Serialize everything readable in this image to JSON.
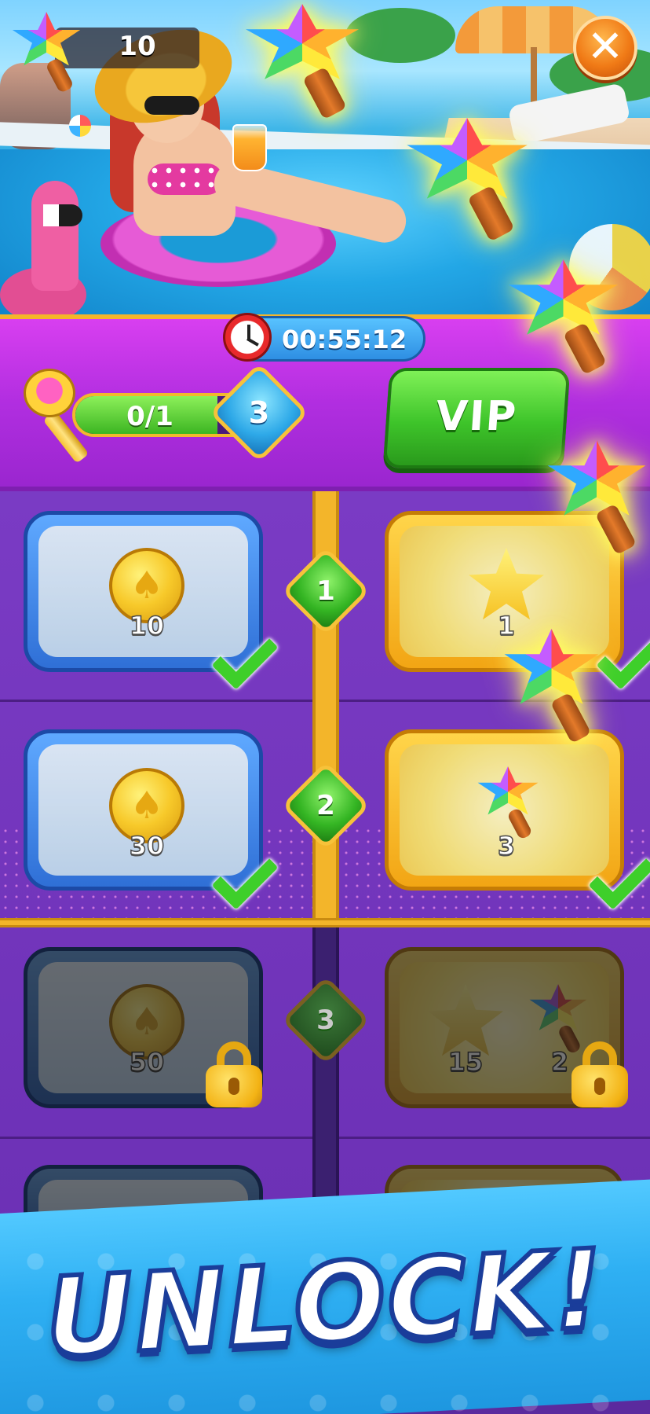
{
  "hud": {
    "wand_count": "10",
    "close_label": "✕"
  },
  "event": {
    "timer": "00:55:12",
    "key_progress": "0/1",
    "key_progress_value": 0.0,
    "level": "3",
    "vip_label": "VIP"
  },
  "tiers": [
    {
      "level": "1",
      "free": {
        "reward": "coin",
        "amount": "10",
        "claimed": true
      },
      "vip": {
        "reward": "star",
        "amount": "1",
        "claimed": true
      }
    },
    {
      "level": "2",
      "free": {
        "reward": "coin",
        "amount": "30",
        "claimed": true
      },
      "vip": {
        "reward": "wand",
        "amount": "3",
        "claimed": true
      }
    },
    {
      "level": "3",
      "free": {
        "reward": "coin",
        "amount": "50",
        "locked": true
      },
      "vip": {
        "rewards": [
          {
            "reward": "star",
            "amount": "15"
          },
          {
            "reward": "wand",
            "amount": "2"
          }
        ],
        "locked": true
      }
    }
  ],
  "banner": {
    "text": "UNLOCK!"
  },
  "icons": {
    "wand": "pinwheel-wand-icon",
    "coin": "spade-coin-icon",
    "star": "star-icon",
    "check": "checkmark-icon",
    "lock": "padlock-icon",
    "clock": "alarm-clock-icon",
    "key": "golden-key-icon",
    "close": "close-icon"
  },
  "colors": {
    "header": "#b12ee0",
    "track": "#7a3bc4",
    "gold": "#f3b52a",
    "vip_green": "#3ec42a",
    "banner_blue": "#2fb0f3"
  }
}
